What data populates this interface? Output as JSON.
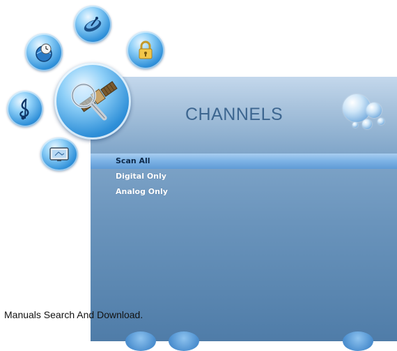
{
  "menu": {
    "title": "CHANNELS",
    "items": [
      {
        "label": "Scan All",
        "selected": true
      },
      {
        "label": "Digital Only",
        "selected": false
      },
      {
        "label": "Analog Only",
        "selected": false
      }
    ]
  },
  "icons": [
    {
      "name": "satellite-dish-icon",
      "active": false
    },
    {
      "name": "clock-globe-icon",
      "active": false
    },
    {
      "name": "lock-icon",
      "active": false
    },
    {
      "name": "search-satellite-icon",
      "active": true
    },
    {
      "name": "music-note-icon",
      "active": false
    },
    {
      "name": "tv-screen-icon",
      "active": false
    }
  ],
  "footer": {
    "text": "Manuals Search And Download."
  },
  "colors": {
    "panel": "#6a94bc",
    "title": "#3d6690",
    "selection": "#7fb4e6",
    "item_text": "#ffffff"
  }
}
